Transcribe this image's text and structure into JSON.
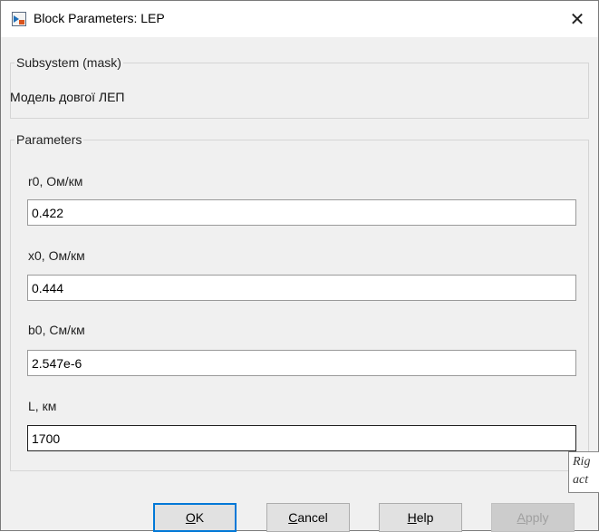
{
  "window": {
    "title": "Block Parameters: LEP",
    "close_glyph": "✕"
  },
  "subsystem": {
    "legend": "Subsystem (mask)",
    "description": "Модель довгої ЛЕП"
  },
  "parameters": {
    "legend": "Parameters",
    "fields": [
      {
        "label": "r0, Ом/км",
        "value": "0.422"
      },
      {
        "label": "x0, Ом/км",
        "value": "0.444"
      },
      {
        "label": "b0, См/км",
        "value": "2.547e-6"
      },
      {
        "label": "L, км",
        "value": "1700"
      }
    ]
  },
  "tooltip": {
    "line1": "Rig",
    "line2": "act"
  },
  "buttons": {
    "ok": {
      "accel": "O",
      "rest": "K"
    },
    "cancel": {
      "accel": "C",
      "rest": "ancel"
    },
    "help": {
      "accel": "H",
      "rest": "elp"
    },
    "apply": {
      "accel": "A",
      "rest": "pply"
    }
  },
  "icons": {
    "app": "simulink-block-icon",
    "close": "close-icon"
  },
  "colors": {
    "default_button_border": "#0078d7",
    "disabled_text": "#a0a0a0"
  }
}
